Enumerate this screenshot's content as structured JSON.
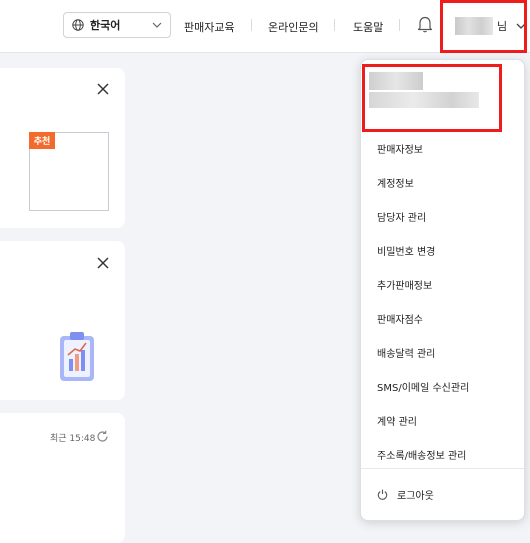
{
  "header": {
    "language": "한국어",
    "links": [
      "판매자교육",
      "온라인문의",
      "도움말"
    ],
    "user_suffix": "님"
  },
  "cards": {
    "recommend_badge": "추천",
    "updated_time": "최근 15:48"
  },
  "dropdown": {
    "items": [
      "판매자정보",
      "계정정보",
      "담당자 관리",
      "비밀번호 변경",
      "추가판매정보",
      "판매자점수",
      "배송달력 관리",
      "SMS/이메일 수신관리",
      "계약 관리",
      "주소록/배송정보 관리"
    ],
    "logout": "로그아웃"
  },
  "colors": {
    "highlight_border": "#ef1c1c",
    "badge": "#f26b2d"
  }
}
